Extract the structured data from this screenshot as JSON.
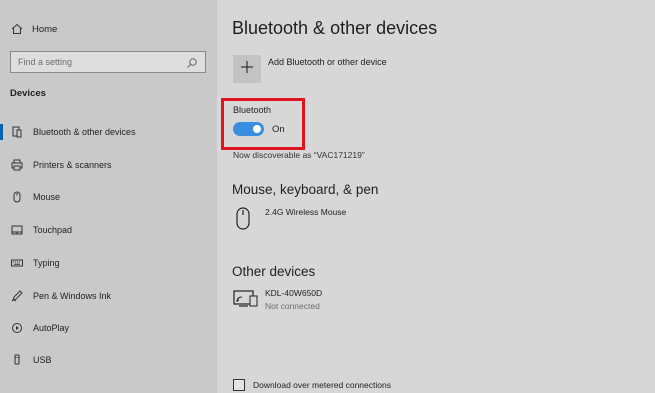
{
  "sidebar": {
    "home_label": "Home",
    "search_placeholder": "Find a setting",
    "section_label": "Devices",
    "items": [
      {
        "label": "Bluetooth & other devices",
        "icon": "bluetooth-devices-icon",
        "active": true
      },
      {
        "label": "Printers & scanners",
        "icon": "printer-icon"
      },
      {
        "label": "Mouse",
        "icon": "mouse-icon"
      },
      {
        "label": "Touchpad",
        "icon": "touchpad-icon"
      },
      {
        "label": "Typing",
        "icon": "keyboard-icon"
      },
      {
        "label": "Pen & Windows Ink",
        "icon": "pen-icon"
      },
      {
        "label": "AutoPlay",
        "icon": "autoplay-icon"
      },
      {
        "label": "USB",
        "icon": "usb-icon"
      }
    ]
  },
  "main": {
    "title": "Bluetooth & other devices",
    "add_label": "Add Bluetooth or other device",
    "bluetooth": {
      "label": "Bluetooth",
      "state": "On",
      "on": true,
      "discoverable_text": "Now discoverable as “VAC171219”"
    },
    "mouse_section": {
      "heading": "Mouse, keyboard, & pen",
      "devices": [
        {
          "name": "2.4G Wireless Mouse",
          "status": "",
          "icon": "mouse-icon"
        }
      ]
    },
    "other_section": {
      "heading": "Other devices",
      "devices": [
        {
          "name": "KDL-40W650D",
          "status": "Not connected",
          "icon": "wireless-display-icon"
        }
      ]
    },
    "metered_label": "Download over metered connections"
  },
  "colors": {
    "accent": "#0063b1",
    "toggle_on": "#3a8ee0",
    "highlight_box": "#e0141e"
  }
}
